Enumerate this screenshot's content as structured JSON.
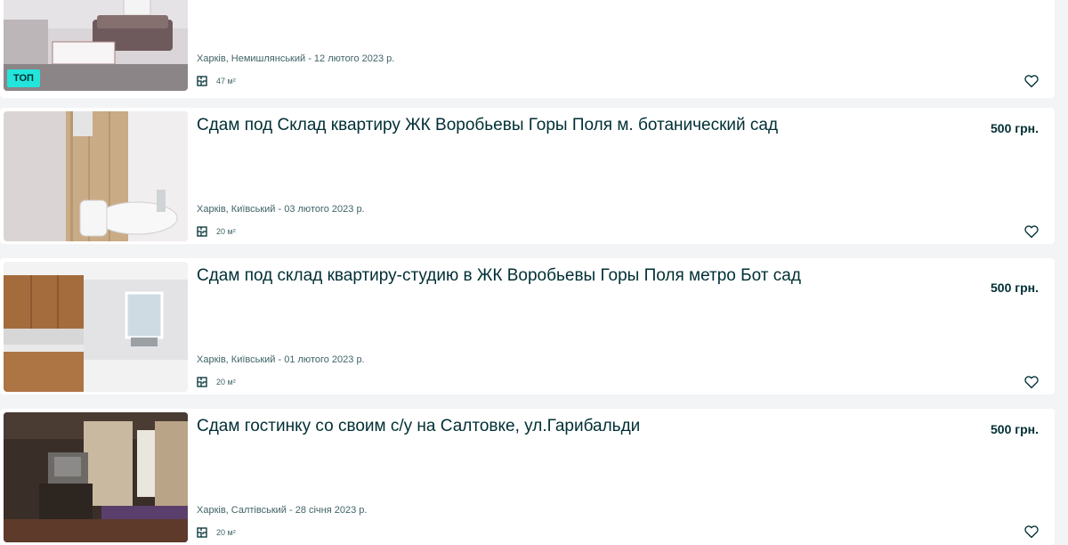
{
  "listings": [
    {
      "title": "",
      "price": "",
      "location_date": "Харків, Немишлянський - 12 лютого 2023 р.",
      "area": "47 м²",
      "badge": "ТОП"
    },
    {
      "title": "Сдам под Склад квартиру ЖК Воробьевы Горы Поля м. ботанический сад",
      "price": "500 грн.",
      "location_date": "Харків, Київський - 03 лютого 2023 р.",
      "area": "20 м²"
    },
    {
      "title": "Сдам под склад квартиру-студию в ЖК Воробьевы Горы Поля метро Бот сад",
      "price": "500 грн.",
      "location_date": "Харків, Київський - 01 лютого 2023 р.",
      "area": "20 м²"
    },
    {
      "title": "Сдам гостинку со своим с/у на Салтовке, ул.Гарибальди",
      "price": "500 грн.",
      "location_date": "Харків, Салтівський - 28 січня 2023 р.",
      "area": "20 м²"
    }
  ],
  "icons": {
    "area": "floor-plan-icon",
    "favorite": "heart-outline-icon"
  },
  "colors": {
    "badge": "#23e5db",
    "text": "#002f34",
    "meta": "#406367",
    "background": "#f2f4f5"
  }
}
